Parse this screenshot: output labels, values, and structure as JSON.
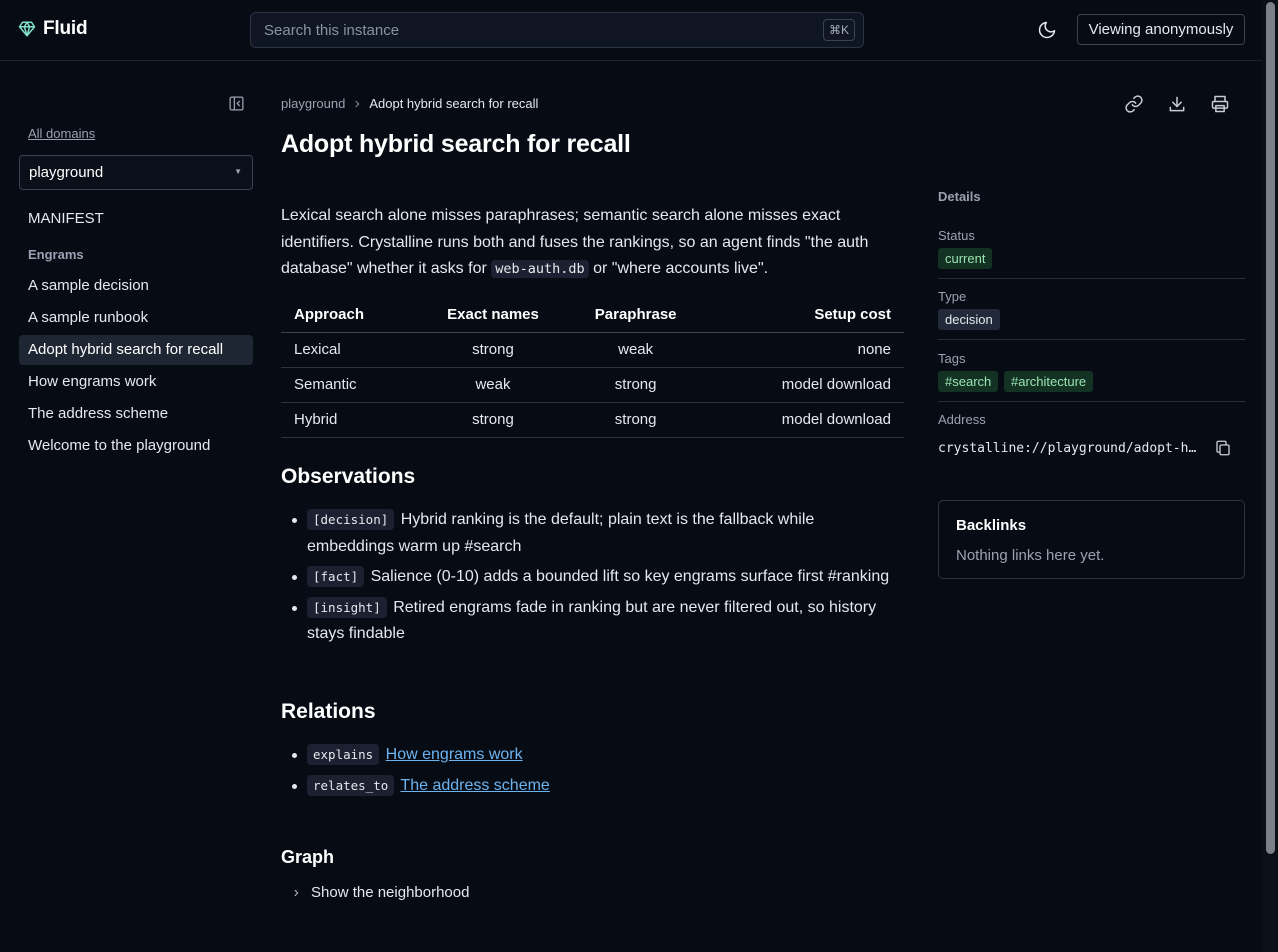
{
  "brand": {
    "name": "Fluid",
    "icon": "gem-icon",
    "accent": "#7ee0c8"
  },
  "search": {
    "placeholder": "Search this instance",
    "shortcut": "⌘K"
  },
  "header": {
    "theme_icon": "moon-icon",
    "viewing_label": "Viewing anonymously"
  },
  "sidebar": {
    "all_domains": "All domains",
    "domain_selected": "playground",
    "manifest": "MANIFEST",
    "engrams_heading": "Engrams",
    "items": [
      {
        "label": "A sample decision",
        "active": false
      },
      {
        "label": "A sample runbook",
        "active": false
      },
      {
        "label": "Adopt hybrid search for recall",
        "active": true
      },
      {
        "label": "How engrams work",
        "active": false
      },
      {
        "label": "The address scheme",
        "active": false
      },
      {
        "label": "Welcome to the playground",
        "active": false
      }
    ]
  },
  "breadcrumb": {
    "parent": "playground",
    "current": "Adopt hybrid search for recall"
  },
  "page": {
    "title": "Adopt hybrid search for recall",
    "intro_part1": "Lexical search alone misses paraphrases; semantic search alone misses exact identifiers. Crystalline runs both and fuses the rankings, so an agent finds \"the auth database\" whether it asks for ",
    "intro_code": "web-auth.db",
    "intro_part2": " or \"where accounts live\"."
  },
  "table": {
    "headers": [
      "Approach",
      "Exact names",
      "Paraphrase",
      "Setup cost"
    ],
    "rows": [
      [
        "Lexical",
        "strong",
        "weak",
        "none"
      ],
      [
        "Semantic",
        "weak",
        "strong",
        "model download"
      ],
      [
        "Hybrid",
        "strong",
        "strong",
        "model download"
      ]
    ]
  },
  "observations": {
    "heading": "Observations",
    "items": [
      {
        "tag": "[decision]",
        "text": "Hybrid ranking is the default; plain text is the fallback while embeddings warm up #search"
      },
      {
        "tag": "[fact]",
        "text": "Salience (0-10) adds a bounded lift so key engrams surface first #ranking"
      },
      {
        "tag": "[insight]",
        "text": "Retired engrams fade in ranking but are never filtered out, so history stays findable"
      }
    ]
  },
  "relations": {
    "heading": "Relations",
    "items": [
      {
        "type": "explains",
        "target": "How engrams work"
      },
      {
        "type": "relates_to",
        "target": "The address scheme"
      }
    ]
  },
  "graph": {
    "heading": "Graph",
    "toggle_label": "Show the neighborhood"
  },
  "details": {
    "title": "Details",
    "status_label": "Status",
    "status_value": "current",
    "type_label": "Type",
    "type_value": "decision",
    "tags_label": "Tags",
    "tags": [
      "#search",
      "#architecture"
    ],
    "address_label": "Address",
    "address_value": "crystalline://playground/adopt-hybrid-search-for-recall"
  },
  "backlinks": {
    "title": "Backlinks",
    "empty": "Nothing links here yet."
  }
}
